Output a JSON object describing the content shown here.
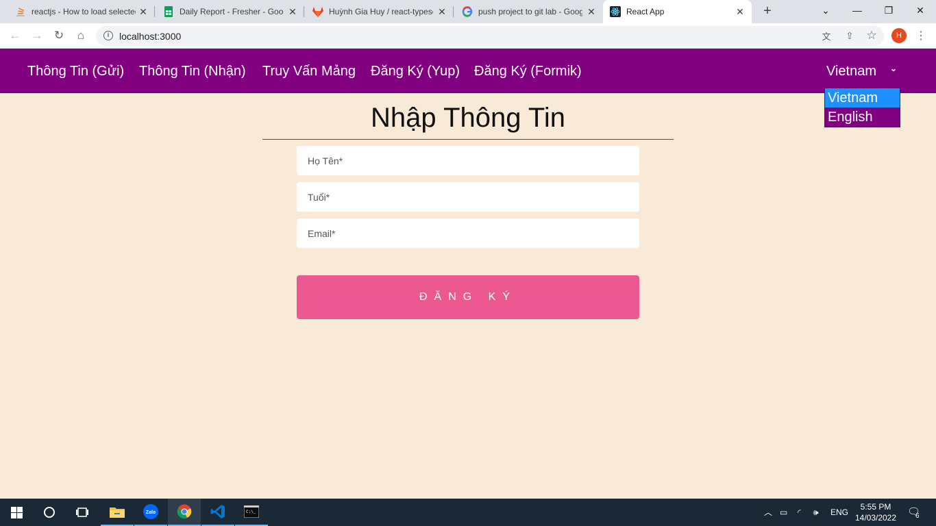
{
  "browser": {
    "tabs": [
      {
        "title": "reactjs - How to load selected"
      },
      {
        "title": "Daily Report - Fresher - Google"
      },
      {
        "title": "Huỳnh Gia Huy / react-typescript"
      },
      {
        "title": "push project to git lab - Google"
      },
      {
        "title": "React App"
      }
    ],
    "url": "localhost:3000",
    "profile_initial": "H"
  },
  "nav": {
    "links": [
      "Thông Tin (Gửi)",
      "Thông Tin (Nhận)",
      "Truy Vấn Mảng",
      "Đăng Ký (Yup)",
      "Đăng Ký (Formik)"
    ],
    "language_selected": "Vietnam",
    "language_options": [
      "Vietnam",
      "English"
    ]
  },
  "form": {
    "title": "Nhập Thông Tin",
    "name_placeholder": "Họ Tên*",
    "age_placeholder": "Tuổi*",
    "email_placeholder": "Email*",
    "submit_label": "ĐĂNG KÝ"
  },
  "taskbar": {
    "language": "ENG",
    "time": "5:55 PM",
    "date": "14/03/2022",
    "notification_count": "6"
  },
  "colors": {
    "nav_bg": "#800080",
    "page_bg": "#f9ead7",
    "submit_bg": "#ec5990",
    "option_highlight": "#1e90ff"
  }
}
